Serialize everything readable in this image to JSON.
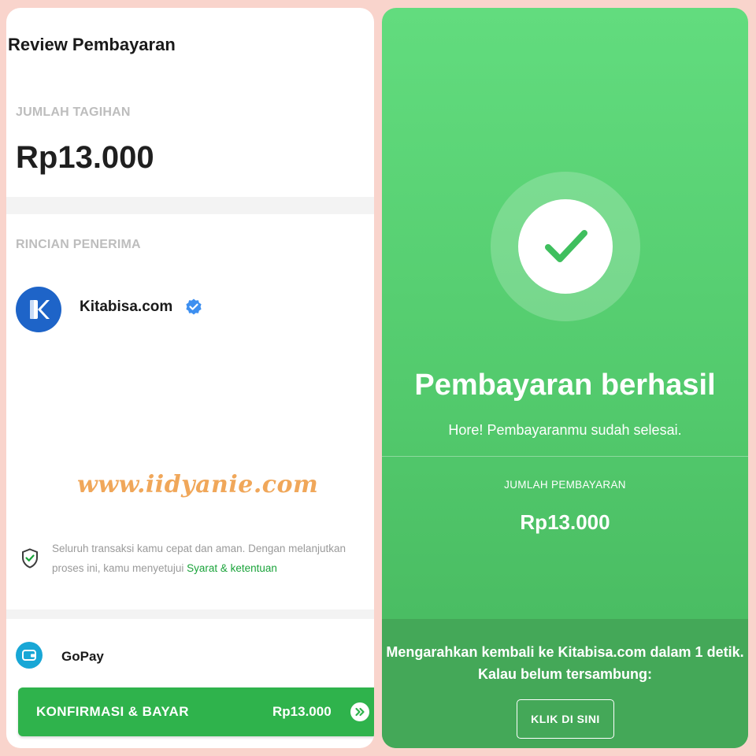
{
  "review": {
    "title": "Review Pembayaran",
    "bill_label": "JUMLAH TAGIHAN",
    "bill_amount": "Rp13.000",
    "recipient_label": "RINCIAN PENERIMA",
    "recipient_name": "Kitabisa.com",
    "recipient_logo_letter": "K",
    "watermark": "www.iidyanie.com",
    "security_text": "Seluruh transaksi kamu cepat dan aman. Dengan melanjutkan proses ini, kamu menyetujui ",
    "terms_link": "Syarat & ketentuan",
    "payment_method": "GoPay",
    "confirm_label": "KONFIRMASI & BAYAR",
    "confirm_amount": "Rp13.000"
  },
  "success": {
    "title": "Pembayaran berhasil",
    "subtitle": "Hore! Pembayaranmu sudah selesai.",
    "amount_label": "JUMLAH PEMBAYARAN",
    "amount": "Rp13.000",
    "redirect_text": "Mengarahkan kembali ke Kitabisa.com dalam 1 detik. Kalau belum tersambung:",
    "click_label": "KLIK DI SINI"
  },
  "colors": {
    "primary_green": "#2fb34c",
    "success_bg": "#52c96c",
    "link_green": "#1aa33a",
    "kitabisa_blue": "#1e64c8",
    "gopay_blue": "#18a7d6",
    "watermark_orange": "#f0a75a"
  },
  "icons": [
    "verified-badge-icon",
    "shield-check-icon",
    "gopay-wallet-icon",
    "double-chevron-right-icon",
    "checkmark-icon"
  ]
}
